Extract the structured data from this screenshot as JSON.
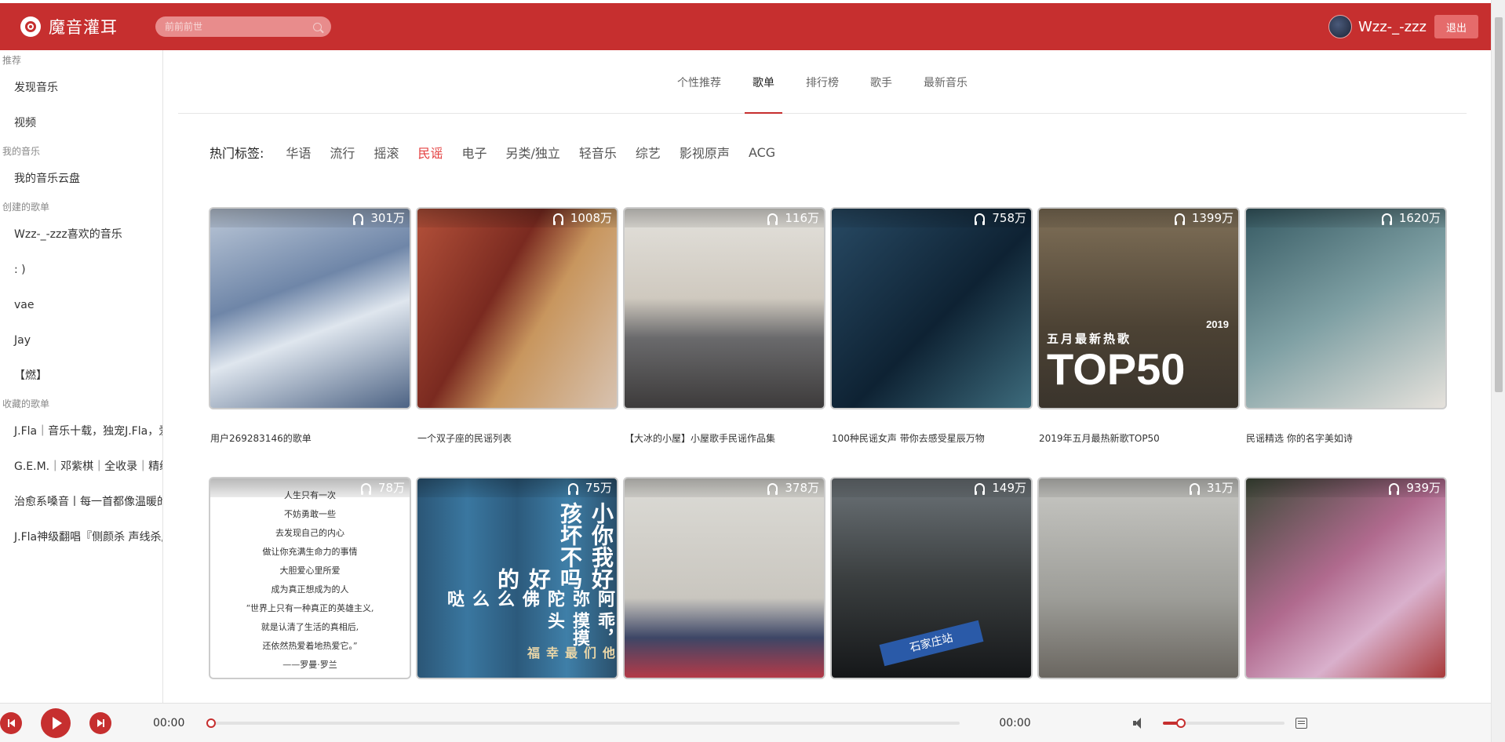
{
  "header": {
    "logo_text": "魔音灌耳",
    "search_placeholder": "前前前世",
    "username": "Wzz-_-zzz",
    "logout_label": "退出",
    "accent": "#c62f2f"
  },
  "sidebar": {
    "groups": [
      {
        "label": "推荐",
        "items": [
          "发现音乐",
          "视频"
        ]
      },
      {
        "label": "我的音乐",
        "items": [
          "我的音乐云盘"
        ]
      },
      {
        "label": "创建的歌单",
        "items": [
          "Wzz-_-zzz喜欢的音乐",
          ": )",
          "vae",
          "Jay",
          "【燃】"
        ]
      },
      {
        "label": "收藏的歌单",
        "items": [
          "J.Fla｜音乐十载，独宠J.Fla，爱",
          "G.E.M.｜邓紫棋｜全收录｜精编",
          "治愈系嗓音丨每一首都像温暖的",
          "J.Fla神级翻唱『侧颜杀 声线杀』"
        ]
      }
    ]
  },
  "tabs": [
    "个性推荐",
    "歌单",
    "排行榜",
    "歌手",
    "最新音乐"
  ],
  "active_tab": "歌单",
  "tags": {
    "label": "热门标签:",
    "items": [
      "华语",
      "流行",
      "摇滚",
      "民谣",
      "电子",
      "另类/独立",
      "轻音乐",
      "综艺",
      "影视原声",
      "ACG"
    ],
    "active": "民谣"
  },
  "playlists": [
    {
      "count": "301万",
      "title": "用户269283146的歌单",
      "art": "c1"
    },
    {
      "count": "1008万",
      "title": "一个双子座的民谣列表",
      "art": "c2"
    },
    {
      "count": "116万",
      "title": "【大冰的小屋】小屋歌手民谣作品集",
      "art": "c3"
    },
    {
      "count": "758万",
      "title": "100种民谣女声 带你去感受星辰万物",
      "art": "c4"
    },
    {
      "count": "1399万",
      "title": "2019年五月最热新歌TOP50",
      "art": "c5",
      "overlay_sub": "五月最新热歌",
      "overlay_big": "TOP50",
      "overlay_year": "2019"
    },
    {
      "count": "1620万",
      "title": "民谣精选 你的名字美如诗",
      "art": "c6"
    },
    {
      "count": "78万",
      "title": "",
      "art": "c7",
      "poem": [
        "人生只有一次",
        "不妨勇敢一些",
        "去发现自己的内心",
        "做让你充满生命力的事情",
        "大胆爱心里所爱",
        "成为真正想成为的人",
        "“世界上只有一种真正的英雄主义,",
        "就是认清了生活的真相后,",
        "还依然热爱着地热爱它。”",
        "——罗曼·罗兰"
      ]
    },
    {
      "count": "75万",
      "title": "",
      "art": "c8",
      "book_text": [
        "小孩",
        "你坏",
        "我不",
        "好吗好的",
        "阿弥陀佛么么哒",
        "乖，摸摸头",
        "他们最幸福"
      ]
    },
    {
      "count": "378万",
      "title": "",
      "art": "c9"
    },
    {
      "count": "149万",
      "title": "",
      "art": "c10",
      "sign": "石家庄站"
    },
    {
      "count": "31万",
      "title": "",
      "art": "c11"
    },
    {
      "count": "939万",
      "title": "",
      "art": "c12"
    }
  ],
  "player": {
    "time_current": "00:00",
    "time_total": "00:00",
    "progress": 0,
    "volume": 0.15
  }
}
